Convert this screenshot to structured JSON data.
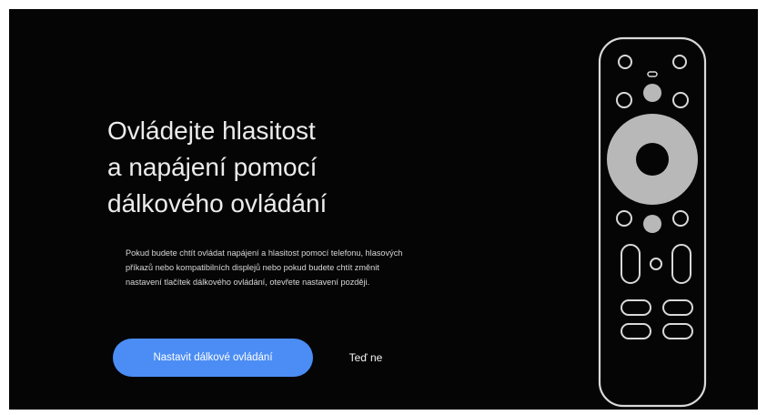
{
  "setup": {
    "title": "Ovládejte hlasitost\na napájení pomocí\ndálkového ovládání",
    "description": "Pokud budete chtít ovládat napájení a hlasitost pomocí telefonu, hlasových příkazů nebo kompatibilních displejů nebo pokud budete chtít změnit nastavení tlačítek dálkového ovládání, otevřete nastavení později.",
    "primary_button": "Nastavit dálkové ovládání",
    "secondary_button": "Teď ne"
  },
  "illustration": {
    "name": "remote-control-illustration",
    "outline_color": "#d9d9d9",
    "fill_color": "#b8b8b8"
  }
}
